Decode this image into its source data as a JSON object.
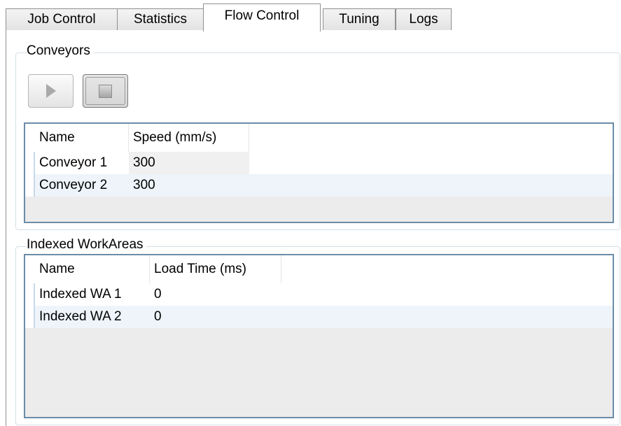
{
  "tabs": [
    {
      "label": "Job Control",
      "active": false
    },
    {
      "label": "Statistics",
      "active": false
    },
    {
      "label": "Flow Control",
      "active": true
    },
    {
      "label": "Tuning",
      "active": false
    },
    {
      "label": "Logs",
      "active": false
    }
  ],
  "conveyors": {
    "group_label": "Conveyors",
    "play_icon": "play-icon",
    "stop_icon": "stop-icon",
    "columns": [
      "Name",
      "Speed (mm/s)"
    ],
    "rows": [
      {
        "name": "Conveyor 1",
        "speed": "300"
      },
      {
        "name": "Conveyor 2",
        "speed": "300"
      }
    ]
  },
  "workareas": {
    "group_label": "Indexed WorkAreas",
    "columns": [
      "Name",
      "Load Time (ms)"
    ],
    "rows": [
      {
        "name": "Indexed WA 1",
        "load_time": "0"
      },
      {
        "name": "Indexed WA 2",
        "load_time": "0"
      }
    ]
  },
  "colors": {
    "grid_border": "#6b8ca8",
    "grid_empty": "#ececec",
    "row_alt": "#eef4fa"
  }
}
